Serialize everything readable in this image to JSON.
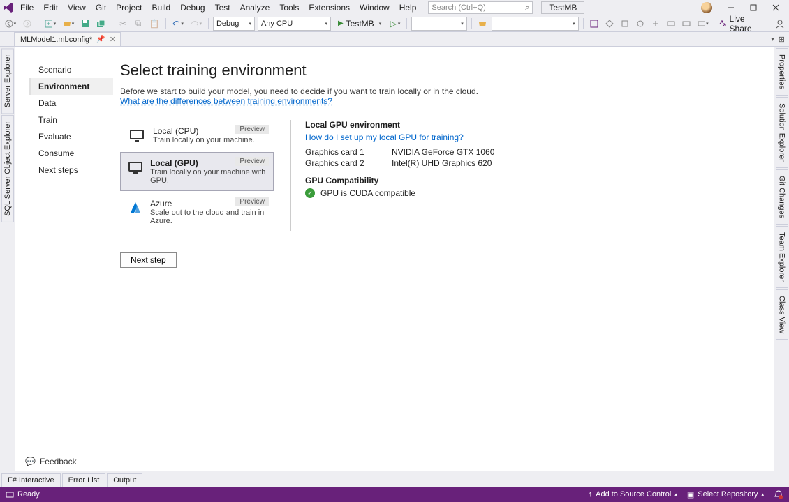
{
  "menu": [
    "File",
    "Edit",
    "View",
    "Git",
    "Project",
    "Build",
    "Debug",
    "Test",
    "Analyze",
    "Tools",
    "Extensions",
    "Window",
    "Help"
  ],
  "search_placeholder": "Search (Ctrl+Q)",
  "solution_name": "TestMB",
  "toolbar": {
    "config": "Debug",
    "platform": "Any CPU",
    "start_label": "TestMB",
    "live_share": "Live Share"
  },
  "tab": {
    "title": "MLModel1.mbconfig*"
  },
  "left_rails": [
    "Server Explorer",
    "SQL Server Object Explorer"
  ],
  "right_rails": [
    "Properties",
    "Solution Explorer",
    "Git Changes",
    "Team Explorer",
    "Class View"
  ],
  "steps": [
    {
      "label": "Scenario"
    },
    {
      "label": "Environment"
    },
    {
      "label": "Data"
    },
    {
      "label": "Train"
    },
    {
      "label": "Evaluate"
    },
    {
      "label": "Consume"
    },
    {
      "label": "Next steps"
    }
  ],
  "active_step": 1,
  "page": {
    "title": "Select training environment",
    "intro": "Before we start to build your model, you need to decide if you want to train locally or in the cloud.",
    "intro_link": "What are the differences between training environments?",
    "cards": [
      {
        "title": "Local (CPU)",
        "desc": "Train locally on your machine.",
        "badge": "Preview",
        "icon": "monitor"
      },
      {
        "title": "Local (GPU)",
        "desc": "Train locally on your machine with GPU.",
        "badge": "Preview",
        "icon": "monitor"
      },
      {
        "title": "Azure",
        "desc": "Scale out to the cloud and train in Azure.",
        "badge": "Preview",
        "icon": "azure"
      }
    ],
    "selected_card": 1,
    "details": {
      "heading": "Local GPU environment",
      "help_link": "How do I set up my local GPU for training?",
      "gpus": [
        {
          "label": "Graphics card 1",
          "name": "NVIDIA GeForce GTX 1060"
        },
        {
          "label": "Graphics card 2",
          "name": "Intel(R) UHD Graphics 620"
        }
      ],
      "compat_heading": "GPU Compatibility",
      "compat_status": "GPU is CUDA compatible"
    },
    "next_button": "Next step",
    "feedback": "Feedback"
  },
  "bottom_tabs": [
    "F# Interactive",
    "Error List",
    "Output"
  ],
  "status": {
    "ready": "Ready",
    "source_control": "Add to Source Control",
    "repo": "Select Repository"
  }
}
